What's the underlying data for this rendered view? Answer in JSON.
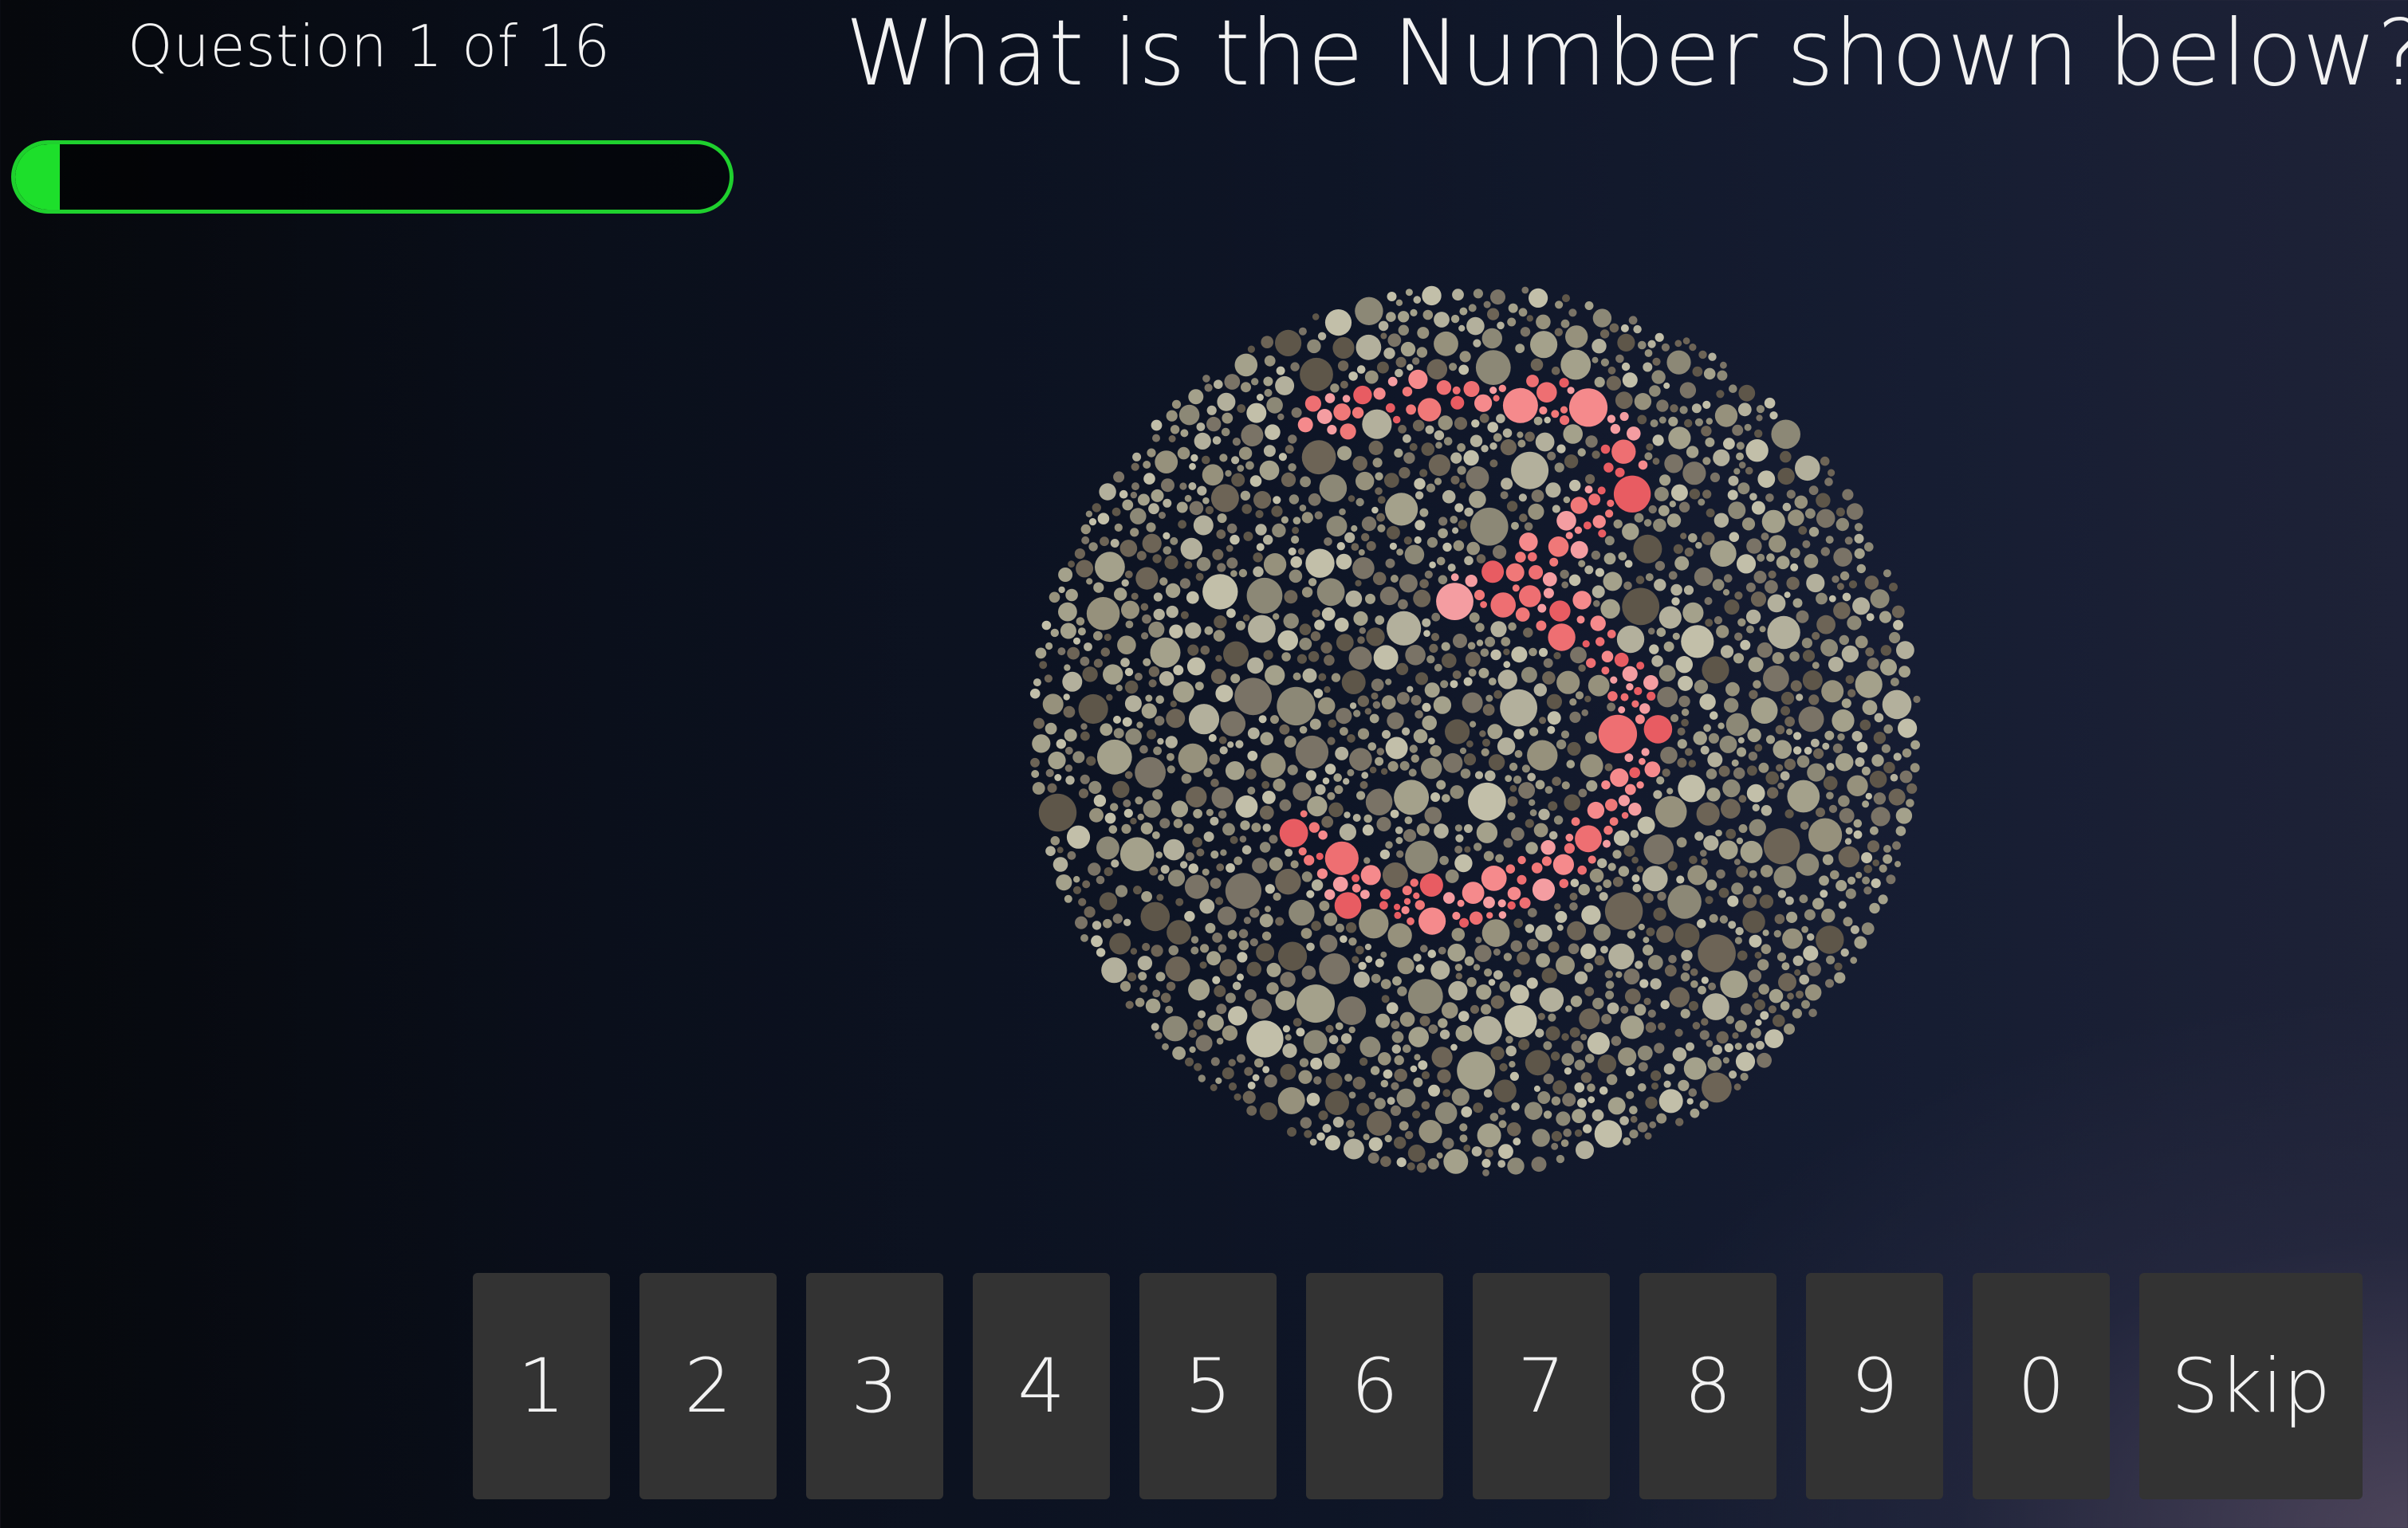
{
  "quiz": {
    "counter_text": "Question 1 of 16",
    "question": "What is the Number shown below?",
    "progress": {
      "current": 1,
      "total": 16,
      "fraction": 0.0625
    }
  },
  "plate": {
    "background_dot_colors": [
      "#8c8876",
      "#a4a18b",
      "#6d6456",
      "#7a7366",
      "#b3b09c",
      "#5e5649",
      "#96917c",
      "#c2bfa9"
    ],
    "figure_dot_colors": [
      "#f07878",
      "#e85c62",
      "#f49da1",
      "#f58a8c",
      "#ee6f72"
    ]
  },
  "keypad": {
    "keys": [
      "1",
      "2",
      "3",
      "4",
      "5",
      "6",
      "7",
      "8",
      "9",
      "0"
    ],
    "skip_label": "Skip"
  },
  "colors": {
    "accent": "#1ddf2b",
    "key_background": "#333333"
  }
}
